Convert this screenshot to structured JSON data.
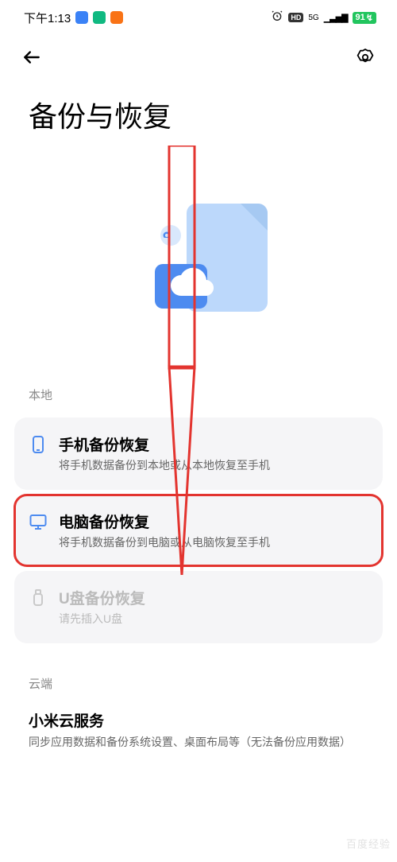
{
  "statusBar": {
    "time": "下午1:13",
    "networkLabel": "5G",
    "hdLabel": "HD",
    "batteryText": "91"
  },
  "pageTitle": "备份与恢复",
  "sections": {
    "local": {
      "label": "本地",
      "items": [
        {
          "title": "手机备份恢复",
          "subtitle": "将手机数据备份到本地或从本地恢复至手机"
        },
        {
          "title": "电脑备份恢复",
          "subtitle": "将手机数据备份到电脑或从电脑恢复至手机"
        },
        {
          "title": "U盘备份恢复",
          "subtitle": "请先插入U盘"
        }
      ]
    },
    "cloud": {
      "label": "云端",
      "service": {
        "title": "小米云服务",
        "subtitle": "同步应用数据和备份系统设置、桌面布局等（无法备份应用数据）"
      }
    }
  },
  "annotation": {
    "color": "#e3342f"
  },
  "watermark": "百度经验"
}
